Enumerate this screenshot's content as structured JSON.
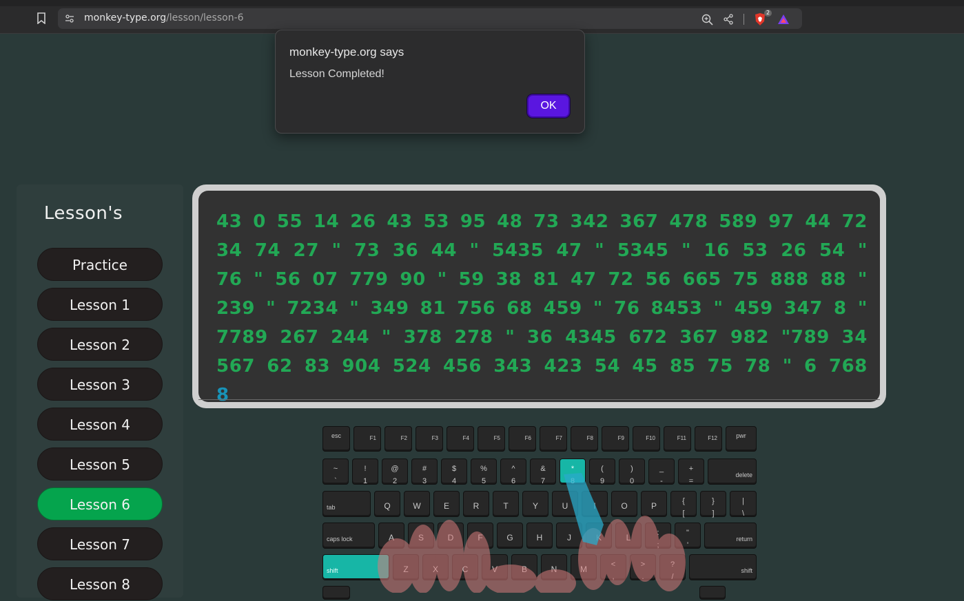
{
  "browser": {
    "url_domain": "monkey-type.org",
    "url_path": "/lesson/lesson-6",
    "shield_count": "2"
  },
  "dialog": {
    "title": "monkey-type.org says",
    "message": "Lesson Completed!",
    "ok_label": "OK"
  },
  "sidebar": {
    "title": "Lesson's",
    "items": [
      {
        "label": "Practice"
      },
      {
        "label": "Lesson 1"
      },
      {
        "label": "Lesson 2"
      },
      {
        "label": "Lesson 3"
      },
      {
        "label": "Lesson 4"
      },
      {
        "label": "Lesson 5"
      },
      {
        "label": "Lesson 6"
      },
      {
        "label": "Lesson 7"
      },
      {
        "label": "Lesson 8"
      }
    ],
    "active": "Lesson 6"
  },
  "typing": {
    "typed_text": "43 0 55 14 26 43 53 95 48 73 342 367 478 589 97 44 72 34 74 27 \" 73 36 44 \" 5435 47 \" 5345 \" 16 53 26 54 \" 76 \" 56 07 779 90 \" 59 38 81 47 72 56 665 75 888 88 \" 239 \" 7234 \" 349 81 756 68 459 \" 76 8453 \" 459 347 8 \" 7789 267 244 \" 378 278 \" 36 4345 672 367 982 \"789 34 567 62 83 904 524 456 343 423 54 45 85 75 78 \" 6 768",
    "current_char": "8"
  },
  "keyboard": {
    "row0": [
      "esc",
      "F1",
      "F2",
      "F3",
      "F4",
      "F5",
      "F6",
      "F7",
      "F8",
      "F9",
      "F10",
      "F11",
      "F12",
      "pwr"
    ],
    "row1": [
      [
        "~",
        "`"
      ],
      [
        "!",
        "1"
      ],
      [
        "@",
        "2"
      ],
      [
        "#",
        "3"
      ],
      [
        "$",
        "4"
      ],
      [
        "%",
        "5"
      ],
      [
        "^",
        "6"
      ],
      [
        "&",
        "7"
      ],
      [
        "*",
        "8"
      ],
      [
        "(",
        "9"
      ],
      [
        ")",
        "0"
      ],
      [
        "_",
        "-"
      ],
      [
        "+",
        "="
      ]
    ],
    "row1_end": "delete",
    "row2_start": "tab",
    "row2": [
      "Q",
      "W",
      "E",
      "R",
      "T",
      "Y",
      "U",
      "I",
      "O",
      "P"
    ],
    "row2_sym": [
      [
        "{",
        "["
      ],
      [
        "}",
        "]"
      ],
      [
        "|",
        "\\"
      ]
    ],
    "row3_start": "caps lock",
    "row3": [
      "A",
      "S",
      "D",
      "F",
      "G",
      "H",
      "J",
      "K",
      "L"
    ],
    "row3_sym": [
      [
        ":",
        ";"
      ],
      [
        "\"",
        "'"
      ]
    ],
    "row3_end": "return",
    "row4_start": "shift",
    "row4": [
      "Z",
      "X",
      "C",
      "V",
      "B",
      "N",
      "M"
    ],
    "row4_sym": [
      [
        "<",
        ","
      ],
      [
        ">",
        "."
      ],
      [
        "?",
        "/"
      ]
    ],
    "row4_end": "shift",
    "highlight_color": "#17b6a6"
  },
  "colors": {
    "background": "#2a3a39",
    "typed": "#22a855",
    "current": "#1893b8",
    "active_lesson": "#05a44d",
    "ok_button": "#5a16e0"
  }
}
